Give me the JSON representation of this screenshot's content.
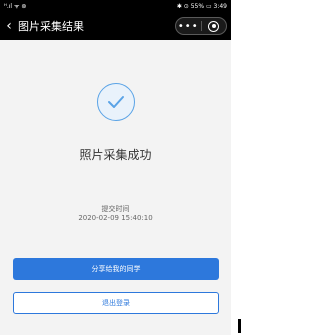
{
  "statusbar": {
    "left": "ᴴ.ıl ᯤ ⊛",
    "right": "✱ ⊙ 55% ▭ 3:49"
  },
  "navbar": {
    "back_icon": "‹",
    "title": "图片采集结果",
    "more_icon": "•••"
  },
  "result": {
    "icon": "check-circle-icon",
    "title": "照片采集成功",
    "submit_label": "提交时间",
    "submit_time": "2020-02-09 15:40:10"
  },
  "actions": {
    "share_label": "分享给我的同学",
    "logout_label": "退出登录"
  },
  "colors": {
    "accent": "#2d78dc",
    "check": "#5aa3e6",
    "background": "#f3f3f3"
  }
}
